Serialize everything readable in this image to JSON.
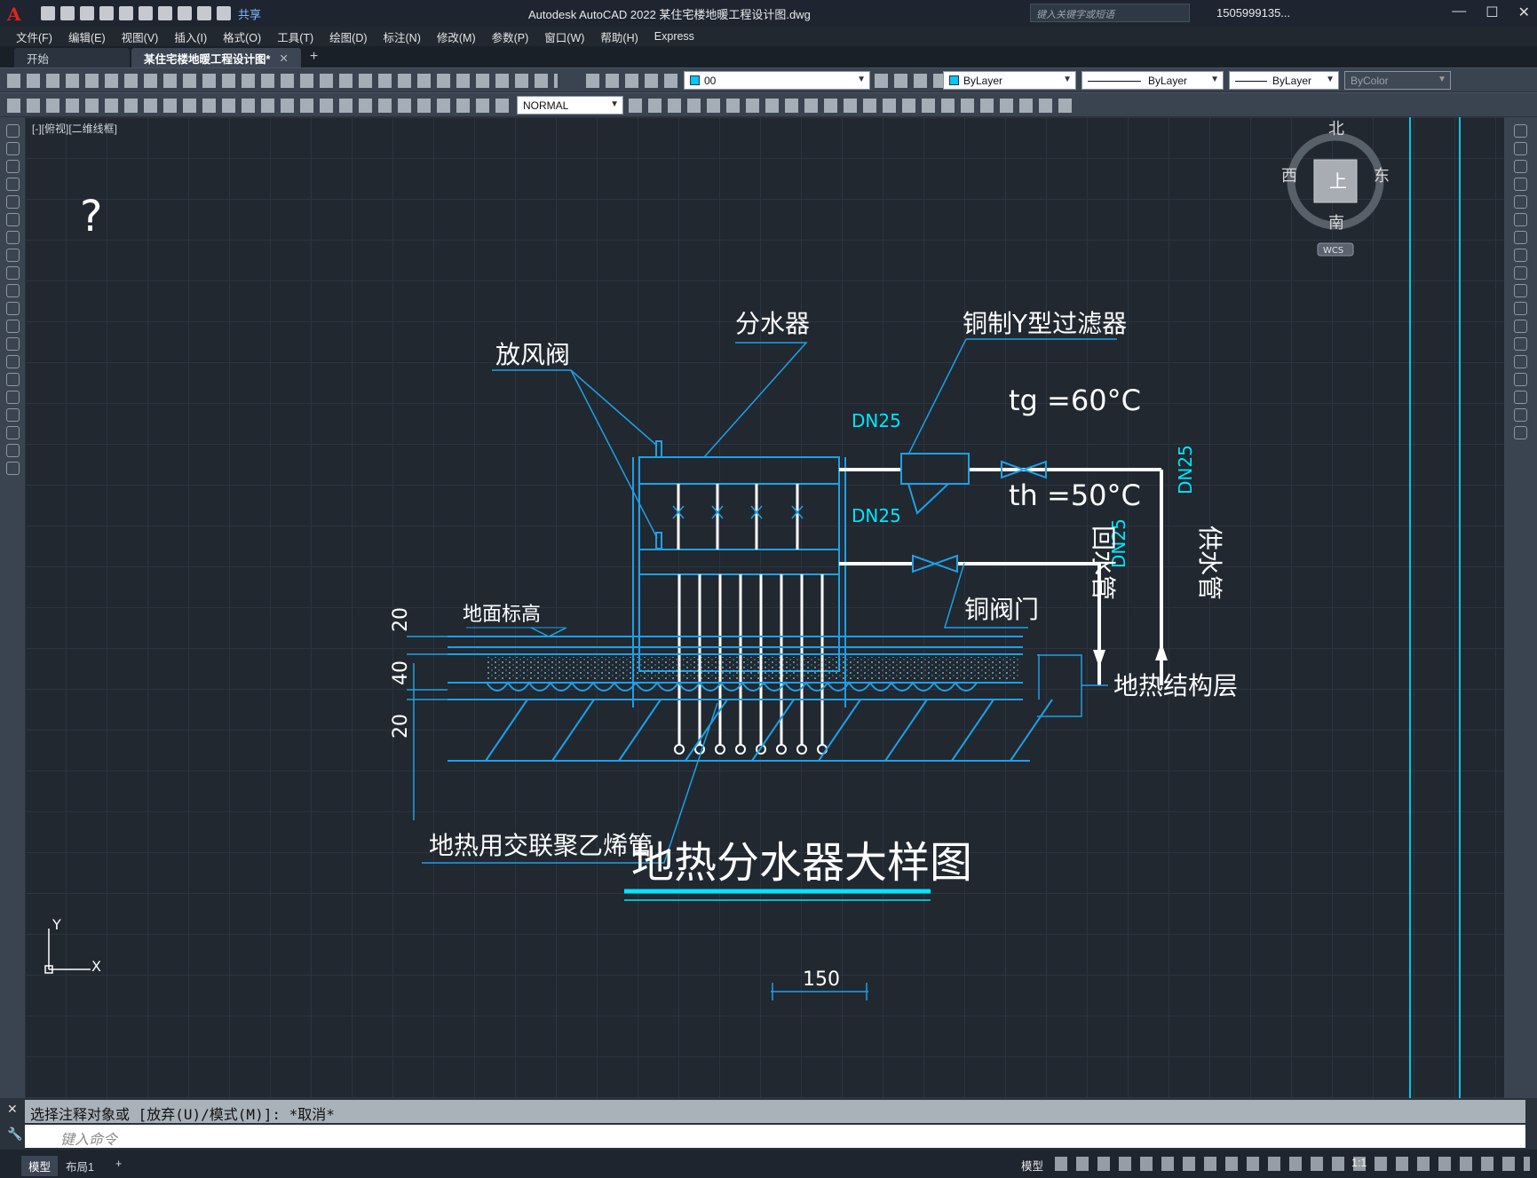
{
  "app": {
    "logo": "A",
    "title": "Autodesk AutoCAD 2022    某住宅楼地暖工程设计图.dwg",
    "search_placeholder": "键入关键字或短语",
    "user": "1505999135...",
    "share_label": "共享"
  },
  "menu": [
    "文件(F)",
    "编辑(E)",
    "视图(V)",
    "插入(I)",
    "格式(O)",
    "工具(T)",
    "绘图(D)",
    "标注(N)",
    "修改(M)",
    "参数(P)",
    "窗口(W)",
    "帮助(H)",
    "Express"
  ],
  "tabs": {
    "start": "开始",
    "active": "某住宅楼地暖工程设计图*",
    "close": "✕",
    "add": "+"
  },
  "toolbar": {
    "layer_value": "00",
    "color_value": "ByLayer",
    "linetype_value": "ByLayer",
    "lineweight_value": "ByLayer",
    "plotstyle_value": "ByColor",
    "textstyle_value": "NORMAL"
  },
  "viewport": {
    "label": "[-][俯视][二维线框]",
    "navcube": {
      "north": "北",
      "south": "南",
      "east": "东",
      "west": "西",
      "top": "上",
      "wcs": "WCS"
    },
    "ucs": {
      "x": "X",
      "y": "Y"
    },
    "question_mark": "?"
  },
  "drawing": {
    "title": "地热分水器大样图",
    "labels": {
      "distributor": "分水器",
      "air_valve": "放风阀",
      "y_filter": "铜制Y型过滤器",
      "tg": "tg =60°C",
      "th": "th =50°C",
      "copper_valve": "铜阀门",
      "return_pipe": "回水管",
      "supply_pipe": "供水管",
      "ground_level": "地面标高",
      "structure_layer": "地热结构层",
      "pex_pipe": "地热用交联聚乙烯管",
      "dn_supply": "DN25",
      "dn_return": "DN25",
      "dn_supply_vertical": "DN25",
      "dn_return_vertical": "DN25"
    },
    "dims": {
      "d1": "20",
      "d2": "40",
      "d3": "20",
      "bottom": "150"
    },
    "colors": {
      "cyan": "#00e5ff",
      "blue_line": "#1ea0e6",
      "white": "#ffffff"
    }
  },
  "command": {
    "history": "选择注释对象或 [放弃(U)/模式(M)]: *取消*",
    "input_placeholder": "键入命令"
  },
  "status": {
    "model_tab": "模型",
    "layout_tab": "布局1",
    "add": "+",
    "model_label": "模型",
    "scale": "1:1"
  }
}
